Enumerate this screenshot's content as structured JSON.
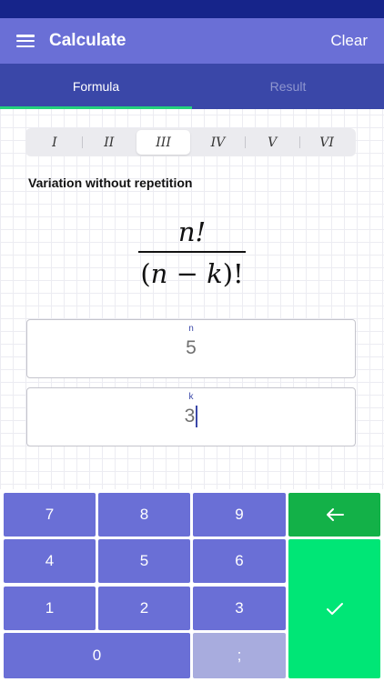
{
  "app_bar": {
    "title": "Calculate",
    "clear_label": "Clear"
  },
  "tabs": [
    {
      "label": "Formula",
      "active": true
    },
    {
      "label": "Result",
      "active": false
    }
  ],
  "segments": {
    "items": [
      "I",
      "II",
      "III",
      "IV",
      "V",
      "VI"
    ],
    "selected": "III"
  },
  "formula": {
    "title": "Variation without repetition",
    "numerator": "n!",
    "denominator": {
      "open": "(",
      "n": "n",
      "minus": " − ",
      "k": "k",
      "close": ")!"
    }
  },
  "fields": {
    "n": {
      "label": "n",
      "value": "5"
    },
    "k": {
      "label": "k",
      "value": "3"
    }
  },
  "keypad": {
    "k7": "7",
    "k8": "8",
    "k9": "9",
    "k4": "4",
    "k5": "5",
    "k6": "6",
    "k1": "1",
    "k2": "2",
    "k3": "3",
    "k0": "0",
    "sep": ";",
    "back_icon": "arrow-left-icon",
    "ok_icon": "check-icon"
  },
  "colors": {
    "status_bar": "#16248a",
    "app_bar": "#6a6fd6",
    "tab_bar": "#3a47a8",
    "tab_indicator": "#24d17d",
    "key": "#6a6fd6",
    "key_back": "#13b148",
    "key_ok": "#00e676"
  }
}
